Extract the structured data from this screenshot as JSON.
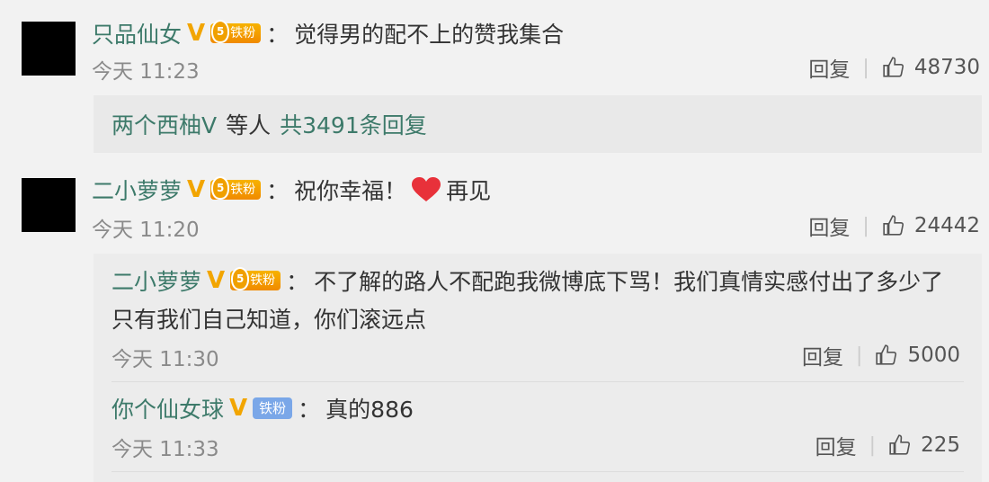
{
  "comments": [
    {
      "username": "只品仙女",
      "verified_badge": "V",
      "fan_badge": "铁粉",
      "fan_level": "5",
      "separator": "：",
      "text": "觉得男的配不上的赞我集合",
      "time": "今天 11:23",
      "reply_label": "回复",
      "likes": "48730",
      "replies_summary": {
        "names": "两个西柚V",
        "connector": "等人",
        "count_text": "共3491条回复"
      }
    },
    {
      "username": "二小萝萝",
      "verified_badge": "V",
      "fan_badge": "铁粉",
      "fan_level": "5",
      "separator": "：",
      "text": "祝你幸福！",
      "text_suffix": "再见",
      "time": "今天 11:20",
      "reply_label": "回复",
      "likes": "24442",
      "replies": [
        {
          "username": "二小萝萝",
          "verified_badge": "V",
          "fan_badge": "铁粉",
          "fan_level": "5",
          "separator": "：",
          "text_line1": "不了解的路人不配跑我微博底下骂！我们真情实感付出了多少了",
          "text_line2": "只有我们自己知道，你们滚远点",
          "time": "今天 11:30",
          "reply_label": "回复",
          "likes": "5000"
        },
        {
          "username": "你个仙女球",
          "verified_badge": "V",
          "fan_badge": "铁粉",
          "separator": "：",
          "text": "真的886",
          "time": "今天 11:33",
          "reply_label": "回复",
          "likes": "225"
        }
      ]
    }
  ],
  "colors": {
    "username": "#3d7a6a",
    "verified": "#f2a500",
    "fan_badge_gold": "#f5a000",
    "fan_badge_blue": "#7aa7e8",
    "heart": "#e8313a"
  },
  "icons": {
    "thumb": "thumbs-up-icon",
    "heart": "heart-icon"
  }
}
